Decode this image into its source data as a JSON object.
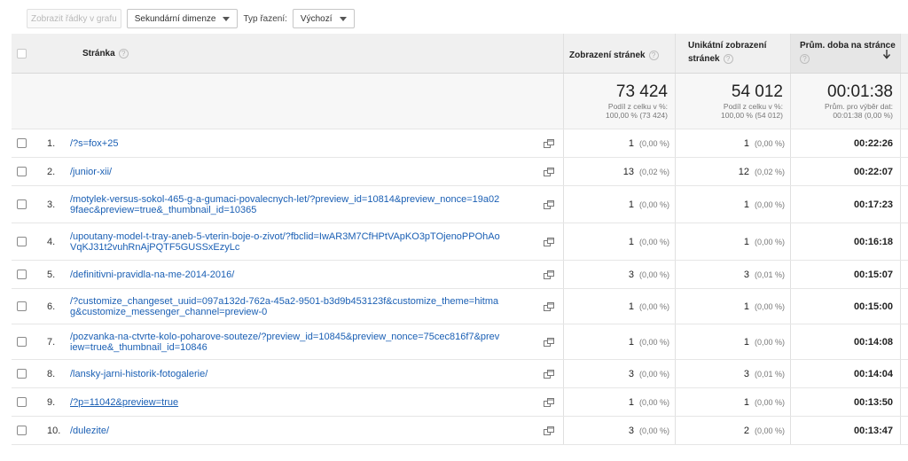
{
  "toolbar": {
    "plot_rows_label": "Zobrazit řádky v grafu",
    "secondary_dimension_label": "Sekundární dimenze",
    "sort_type_label": "Typ řazení:",
    "sort_type_value": "Výchozí"
  },
  "header": {
    "page": "Stránka",
    "pageviews": "Zobrazení stránek",
    "unique_line1": "Unikátní zobrazení",
    "unique_line2": "stránek",
    "avg_time": "Prům. doba na stránce",
    "help_glyph": "?"
  },
  "totals": {
    "pageviews": "73 424",
    "pageviews_sub1": "Podíl z celku v %:",
    "pageviews_sub2": "100,00 % (73 424)",
    "unique": "54 012",
    "unique_sub1": "Podíl z celku v %:",
    "unique_sub2": "100,00 % (54 012)",
    "avg_time": "00:01:38",
    "avg_time_sub1": "Prům. pro výběr dat:",
    "avg_time_sub2": "00:01:38 (0,00 %)"
  },
  "rows": [
    {
      "idx": "1.",
      "page_line1": "/?s=fox+25",
      "page_line2": "",
      "pv": "1",
      "pv_pct": "(0,00 %)",
      "uv": "1",
      "uv_pct": "(0,00 %)",
      "time": "00:22:26"
    },
    {
      "idx": "2.",
      "page_line1": "/junior-xii/",
      "page_line2": "",
      "pv": "13",
      "pv_pct": "(0,02 %)",
      "uv": "12",
      "uv_pct": "(0,02 %)",
      "time": "00:22:07"
    },
    {
      "idx": "3.",
      "page_line1": "/motylek-versus-sokol-465-g-a-gumaci-povalecnych-let/?preview_id=10814&preview_nonce=19a02",
      "page_line2": "9faec&preview=true&_thumbnail_id=10365",
      "pv": "1",
      "pv_pct": "(0,00 %)",
      "uv": "1",
      "uv_pct": "(0,00 %)",
      "time": "00:17:23"
    },
    {
      "idx": "4.",
      "page_line1": "/upoutany-model-t-tray-aneb-5-vterin-boje-o-zivot/?fbclid=IwAR3M7CfHPtVApKO3pTOjenoPPOhAo",
      "page_line2": "VqKJ31t2vuhRnAjPQTF5GUSSxEzyLc",
      "pv": "1",
      "pv_pct": "(0,00 %)",
      "uv": "1",
      "uv_pct": "(0,00 %)",
      "time": "00:16:18"
    },
    {
      "idx": "5.",
      "page_line1": "/definitivni-pravidla-na-me-2014-2016/",
      "page_line2": "",
      "pv": "3",
      "pv_pct": "(0,00 %)",
      "uv": "3",
      "uv_pct": "(0,01 %)",
      "time": "00:15:07"
    },
    {
      "idx": "6.",
      "page_line1": "/?customize_changeset_uuid=097a132d-762a-45a2-9501-b3d9b453123f&customize_theme=hitma",
      "page_line2": "g&customize_messenger_channel=preview-0",
      "pv": "1",
      "pv_pct": "(0,00 %)",
      "uv": "1",
      "uv_pct": "(0,00 %)",
      "time": "00:15:00"
    },
    {
      "idx": "7.",
      "page_line1": "/pozvanka-na-ctvrte-kolo-poharove-souteze/?preview_id=10845&preview_nonce=75cec816f7&prev",
      "page_line2": "iew=true&_thumbnail_id=10846",
      "pv": "1",
      "pv_pct": "(0,00 %)",
      "uv": "1",
      "uv_pct": "(0,00 %)",
      "time": "00:14:08"
    },
    {
      "idx": "8.",
      "page_line1": "/lansky-jarni-historik-fotogalerie/",
      "page_line2": "",
      "pv": "3",
      "pv_pct": "(0,00 %)",
      "uv": "3",
      "uv_pct": "(0,01 %)",
      "time": "00:14:04"
    },
    {
      "idx": "9.",
      "page_line1": "/?p=11042&preview=true",
      "page_line2": "",
      "pv": "1",
      "pv_pct": "(0,00 %)",
      "uv": "1",
      "uv_pct": "(0,00 %)",
      "time": "00:13:50"
    },
    {
      "idx": "10.",
      "page_line1": "/dulezite/",
      "page_line2": "",
      "pv": "3",
      "pv_pct": "(0,00 %)",
      "uv": "2",
      "uv_pct": "(0,00 %)",
      "time": "00:13:47"
    }
  ],
  "colors": {
    "link": "#1a5fb4",
    "header_bg": "#f0f0f0",
    "sorted_header_bg": "#e6e6e6",
    "totals_bg": "#f7f7f7"
  },
  "icons": {
    "external": "open-in-new-window-icon",
    "sort": "arrow-down-icon",
    "help": "help-circle-icon",
    "dropdown": "caret-down-icon"
  }
}
